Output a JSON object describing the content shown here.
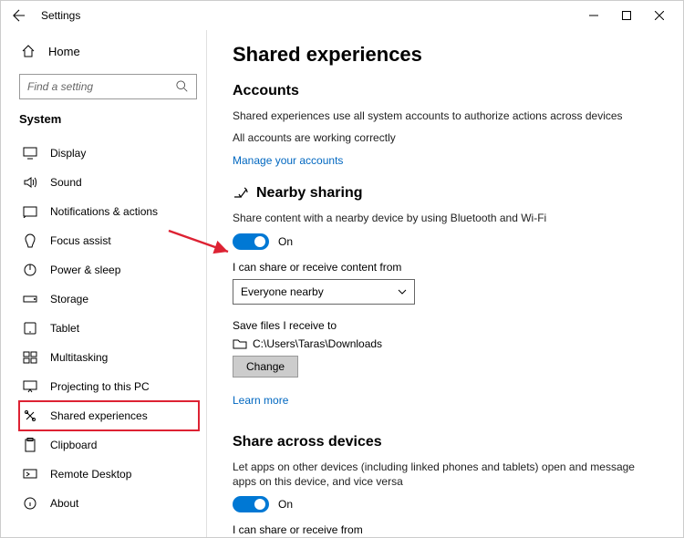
{
  "titlebar": {
    "title": "Settings"
  },
  "sidebar": {
    "home": "Home",
    "search_placeholder": "Find a setting",
    "group": "System",
    "items": [
      {
        "label": "Display"
      },
      {
        "label": "Sound"
      },
      {
        "label": "Notifications & actions"
      },
      {
        "label": "Focus assist"
      },
      {
        "label": "Power & sleep"
      },
      {
        "label": "Storage"
      },
      {
        "label": "Tablet"
      },
      {
        "label": "Multitasking"
      },
      {
        "label": "Projecting to this PC"
      },
      {
        "label": "Shared experiences"
      },
      {
        "label": "Clipboard"
      },
      {
        "label": "Remote Desktop"
      },
      {
        "label": "About"
      }
    ]
  },
  "page": {
    "title": "Shared experiences",
    "accounts": {
      "heading": "Accounts",
      "desc": "Shared experiences use all system accounts to authorize actions across devices",
      "status": "All accounts are working correctly",
      "manage_link": "Manage your accounts"
    },
    "nearby": {
      "heading": "Nearby sharing",
      "desc": "Share content with a nearby device by using Bluetooth and Wi-Fi",
      "toggle_state": "On",
      "from_label": "I can share or receive content from",
      "from_value": "Everyone nearby",
      "save_label": "Save files I receive to",
      "save_path": "C:\\Users\\Taras\\Downloads",
      "change_btn": "Change",
      "learn_more": "Learn more"
    },
    "across": {
      "heading": "Share across devices",
      "desc": "Let apps on other devices (including linked phones and tablets) open and message apps on this device, and vice versa",
      "toggle_state": "On",
      "from_label": "I can share or receive from"
    }
  }
}
